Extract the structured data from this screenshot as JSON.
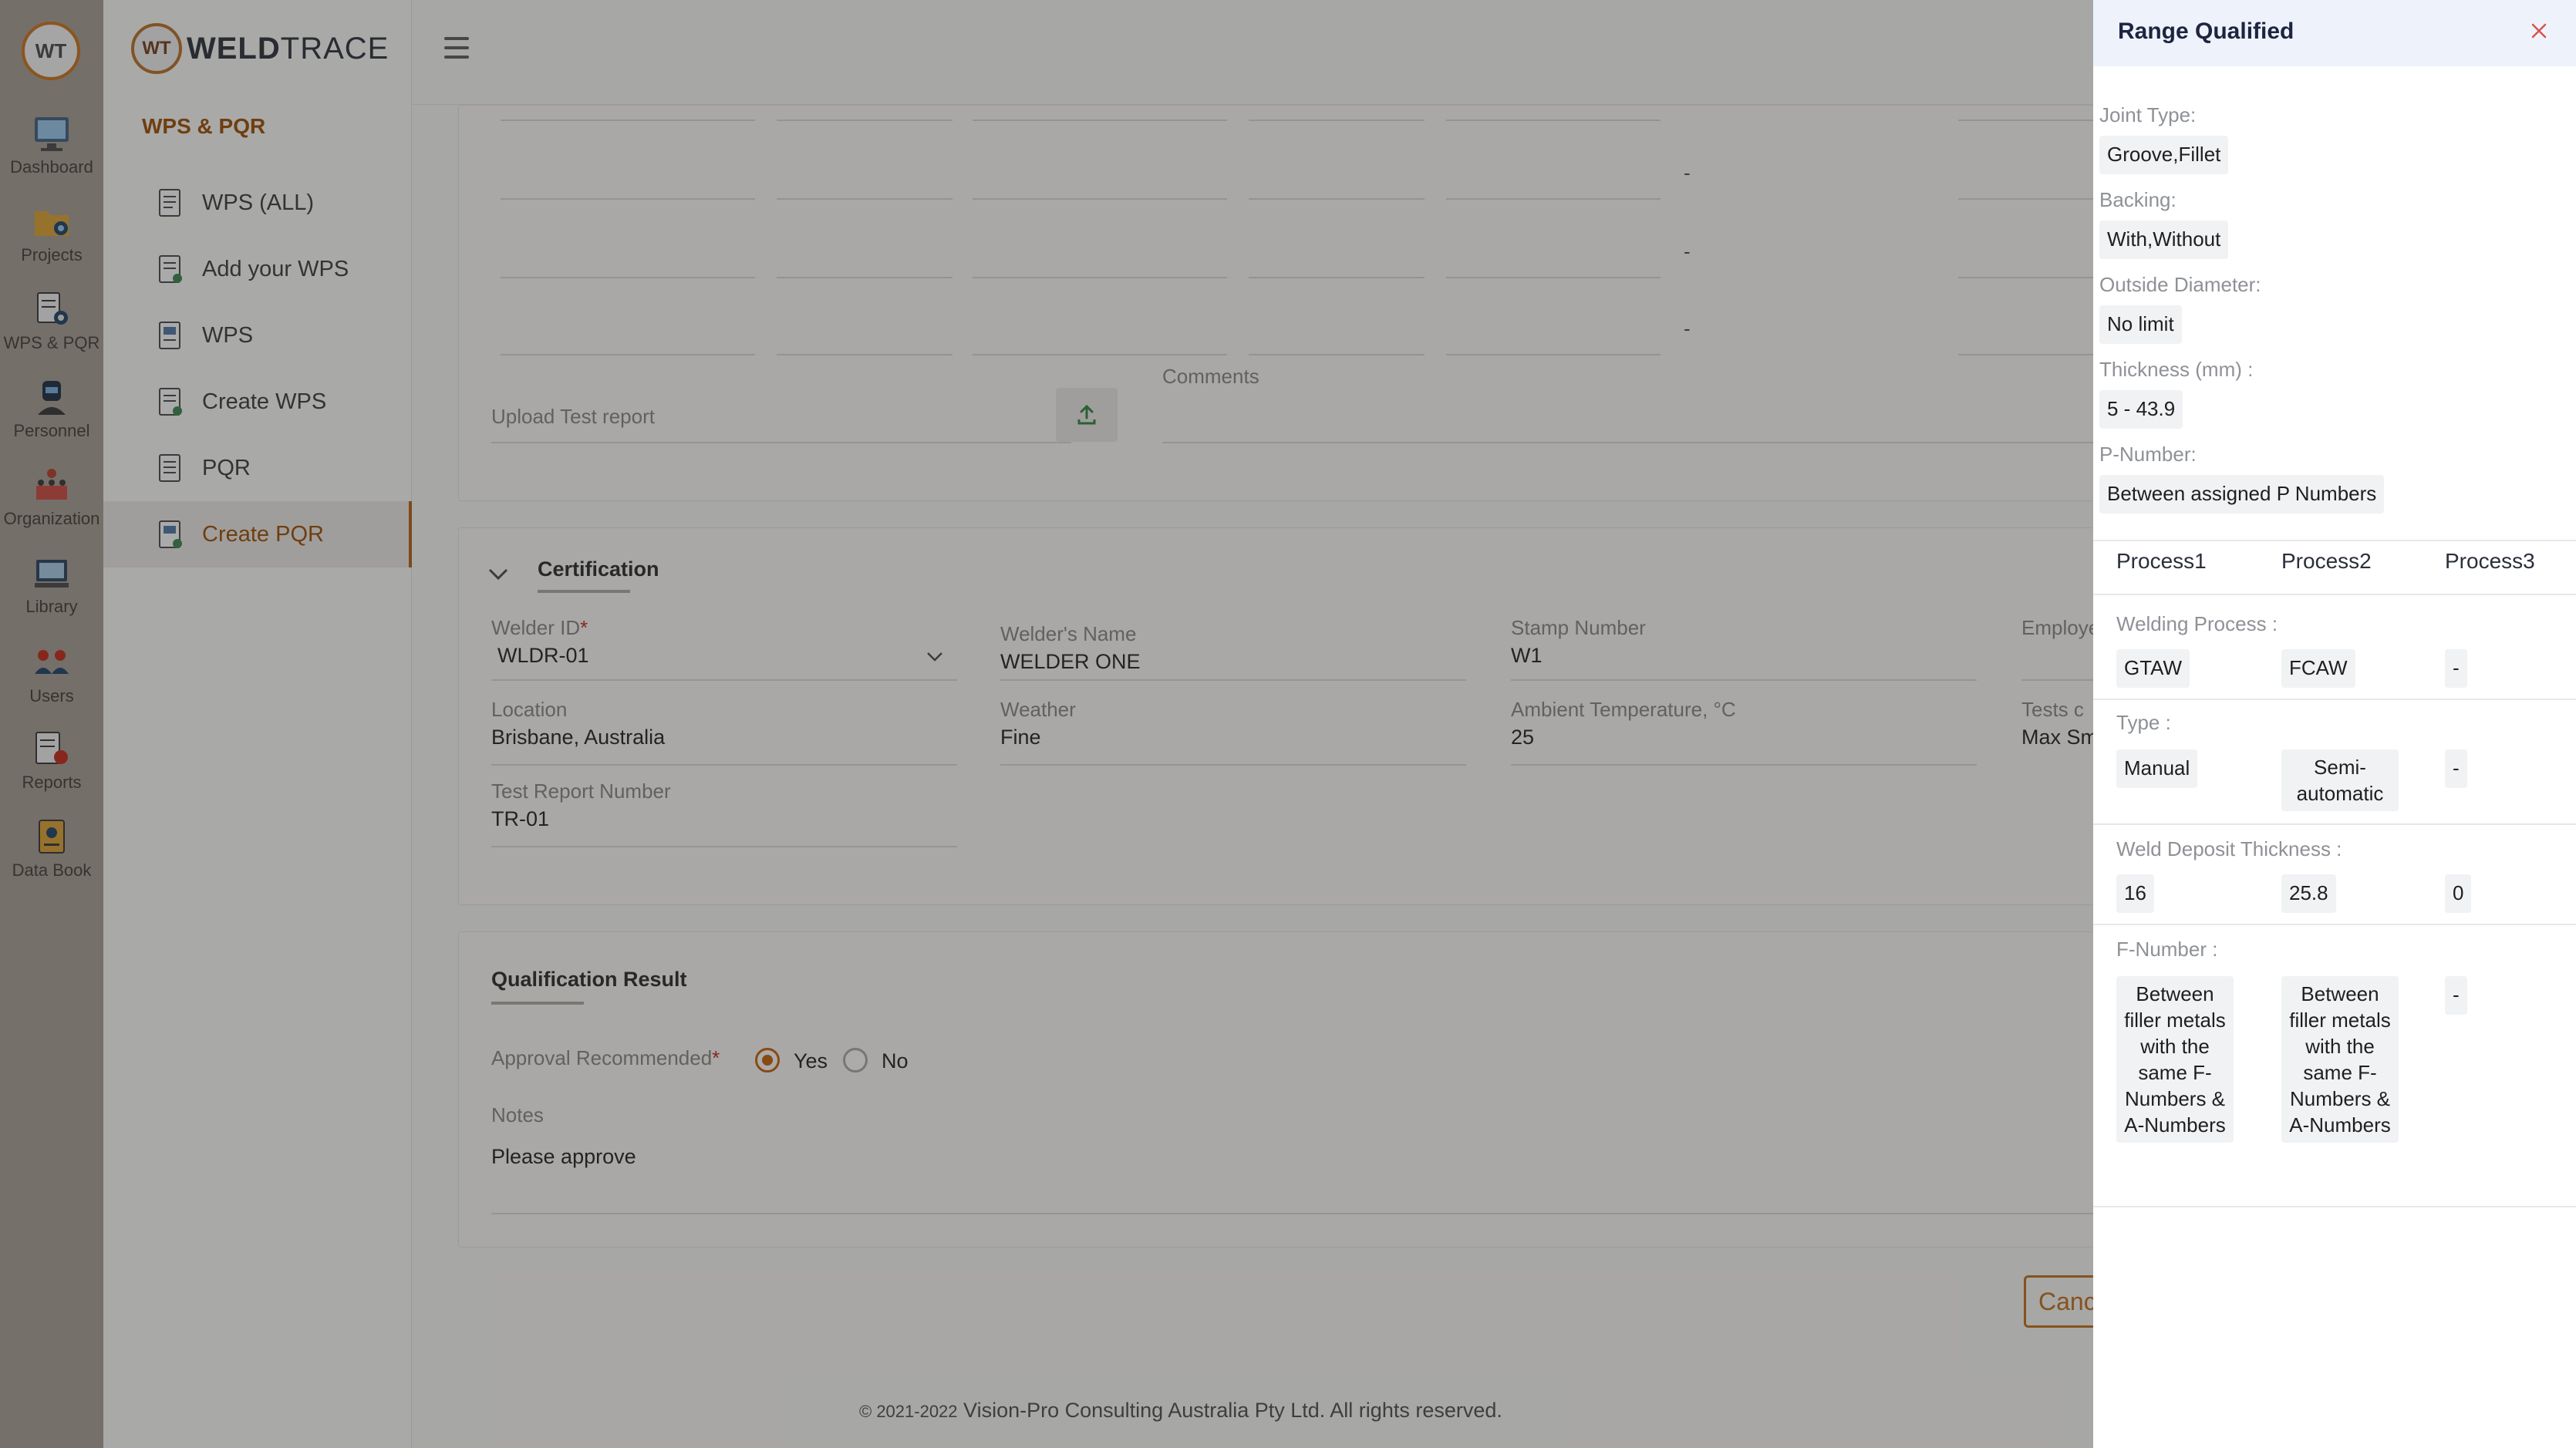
{
  "rail": {
    "logo": "WT",
    "items": [
      {
        "label": "Dashboard"
      },
      {
        "label": "Projects"
      },
      {
        "label": "WPS & PQR"
      },
      {
        "label": "Personnel"
      },
      {
        "label": "Organization"
      },
      {
        "label": "Library"
      },
      {
        "label": "Users"
      },
      {
        "label": "Reports"
      },
      {
        "label": "Data Book"
      }
    ]
  },
  "brand": {
    "badge": "WT",
    "name_bold": "WELD",
    "name_thin": "TRACE"
  },
  "subnav": {
    "title": "WPS & PQR",
    "items": [
      {
        "label": "WPS (ALL)"
      },
      {
        "label": "Add your WPS"
      },
      {
        "label": "WPS"
      },
      {
        "label": "Create WPS"
      },
      {
        "label": "PQR"
      },
      {
        "label": "Create PQR"
      }
    ]
  },
  "upload": {
    "placeholder": "Upload Test report",
    "comments_label": "Comments"
  },
  "dashes": [
    "-",
    "-",
    "-"
  ],
  "certification": {
    "title": "Certification",
    "welder_id": {
      "label": "Welder ID",
      "required": "*",
      "value": "WLDR-01"
    },
    "welder_name": {
      "label": "Welder's Name",
      "value": "WELDER ONE"
    },
    "stamp_number": {
      "label": "Stamp Number",
      "value": "W1"
    },
    "employer": {
      "label": "Employe"
    },
    "location": {
      "label": "Location",
      "value": "Brisbane, Australia"
    },
    "weather": {
      "label": "Weather",
      "value": "Fine"
    },
    "ambient_temp": {
      "label": "Ambient Temperature, °C",
      "value": "25"
    },
    "tests": {
      "label": "Tests c",
      "value": "Max Sm"
    },
    "test_report": {
      "label": "Test Report Number",
      "value": "TR-01"
    }
  },
  "qualification": {
    "title": "Qualification Result",
    "approval_label": "Approval Recommended",
    "required": "*",
    "yes": "Yes",
    "no": "No",
    "notes_label": "Notes",
    "notes_value": "Please approve"
  },
  "buttons": {
    "cancel": "Cancel"
  },
  "footer": {
    "copyright": "© 2021-2022",
    "text": "Vision-Pro Consulting Australia Pty Ltd. All rights reserved."
  },
  "drawer": {
    "title": "Range Qualified",
    "close_icon": "close-icon",
    "joint_type": {
      "label": "Joint Type:",
      "value": "Groove,Fillet"
    },
    "backing": {
      "label": "Backing:",
      "value": "With,Without"
    },
    "outside_diameter": {
      "label": "Outside Diameter:",
      "value": "No limit"
    },
    "thickness": {
      "label": "Thickness (mm) :",
      "value": "5 - 43.9"
    },
    "p_number": {
      "label": "P-Number:",
      "value": "Between assigned P Numbers"
    },
    "processes": [
      "Process1",
      "Process2",
      "Process3"
    ],
    "welding_process": {
      "label": "Welding Process :",
      "values": [
        "GTAW",
        "FCAW",
        "-"
      ]
    },
    "type": {
      "label": "Type :",
      "values": [
        "Manual",
        "Semi-automatic",
        "-"
      ]
    },
    "weld_deposit": {
      "label": "Weld Deposit Thickness :",
      "values": [
        "16",
        "25.8",
        "0"
      ]
    },
    "f_number": {
      "label": "F-Number :",
      "values": [
        "Between filler metals with the same F-Numbers & A-Numbers",
        "Between filler metals with the same F-Numbers & A-Numbers",
        "-"
      ]
    }
  },
  "colors": {
    "accent": "#c0762c",
    "active_text": "#a05a17",
    "drawer_header": "#eef3fb"
  }
}
